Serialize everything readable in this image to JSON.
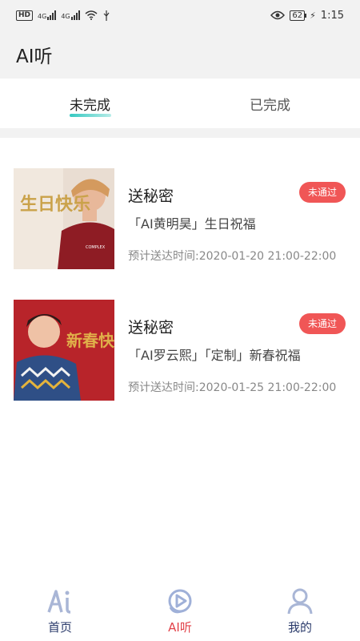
{
  "status_bar": {
    "hd": "HD",
    "signal1": "4G",
    "signal2": "4G",
    "battery": "62",
    "time": "1:15"
  },
  "header": {
    "title": "AI听"
  },
  "tabs": [
    {
      "label": "未完成",
      "active": true
    },
    {
      "label": "已完成",
      "active": false
    }
  ],
  "items": [
    {
      "title": "送秘密",
      "badge": "未通过",
      "subtitle": "「AI黄明昊」生日祝福",
      "time": "预计送达时间:2020-01-20 21:00-22:00",
      "thumb_text": "生日快乐"
    },
    {
      "title": "送秘密",
      "badge": "未通过",
      "subtitle": "「AI罗云熙」「定制」新春祝福",
      "time": "预计送达时间:2020-01-25 21:00-22:00",
      "thumb_text": "新春快乐"
    }
  ],
  "bottom_nav": [
    {
      "label": "首页",
      "icon": "ai-logo-icon",
      "active": false
    },
    {
      "label": "AI听",
      "icon": "listen-play-icon",
      "active": true
    },
    {
      "label": "我的",
      "icon": "user-icon",
      "active": false
    }
  ],
  "colors": {
    "accent_teal": "#35c9c1",
    "badge_red": "#f05656",
    "nav_active": "#e2424a",
    "nav_inactive": "#2b3b6b"
  }
}
